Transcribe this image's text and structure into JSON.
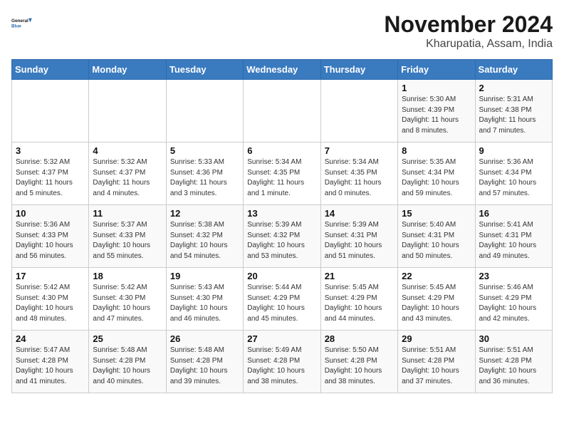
{
  "logo": {
    "line1": "General",
    "line2": "Blue"
  },
  "title": "November 2024",
  "location": "Kharupatia, Assam, India",
  "weekdays": [
    "Sunday",
    "Monday",
    "Tuesday",
    "Wednesday",
    "Thursday",
    "Friday",
    "Saturday"
  ],
  "weeks": [
    [
      {
        "day": "",
        "info": ""
      },
      {
        "day": "",
        "info": ""
      },
      {
        "day": "",
        "info": ""
      },
      {
        "day": "",
        "info": ""
      },
      {
        "day": "",
        "info": ""
      },
      {
        "day": "1",
        "info": "Sunrise: 5:30 AM\nSunset: 4:39 PM\nDaylight: 11 hours\nand 8 minutes."
      },
      {
        "day": "2",
        "info": "Sunrise: 5:31 AM\nSunset: 4:38 PM\nDaylight: 11 hours\nand 7 minutes."
      }
    ],
    [
      {
        "day": "3",
        "info": "Sunrise: 5:32 AM\nSunset: 4:37 PM\nDaylight: 11 hours\nand 5 minutes."
      },
      {
        "day": "4",
        "info": "Sunrise: 5:32 AM\nSunset: 4:37 PM\nDaylight: 11 hours\nand 4 minutes."
      },
      {
        "day": "5",
        "info": "Sunrise: 5:33 AM\nSunset: 4:36 PM\nDaylight: 11 hours\nand 3 minutes."
      },
      {
        "day": "6",
        "info": "Sunrise: 5:34 AM\nSunset: 4:35 PM\nDaylight: 11 hours\nand 1 minute."
      },
      {
        "day": "7",
        "info": "Sunrise: 5:34 AM\nSunset: 4:35 PM\nDaylight: 11 hours\nand 0 minutes."
      },
      {
        "day": "8",
        "info": "Sunrise: 5:35 AM\nSunset: 4:34 PM\nDaylight: 10 hours\nand 59 minutes."
      },
      {
        "day": "9",
        "info": "Sunrise: 5:36 AM\nSunset: 4:34 PM\nDaylight: 10 hours\nand 57 minutes."
      }
    ],
    [
      {
        "day": "10",
        "info": "Sunrise: 5:36 AM\nSunset: 4:33 PM\nDaylight: 10 hours\nand 56 minutes."
      },
      {
        "day": "11",
        "info": "Sunrise: 5:37 AM\nSunset: 4:33 PM\nDaylight: 10 hours\nand 55 minutes."
      },
      {
        "day": "12",
        "info": "Sunrise: 5:38 AM\nSunset: 4:32 PM\nDaylight: 10 hours\nand 54 minutes."
      },
      {
        "day": "13",
        "info": "Sunrise: 5:39 AM\nSunset: 4:32 PM\nDaylight: 10 hours\nand 53 minutes."
      },
      {
        "day": "14",
        "info": "Sunrise: 5:39 AM\nSunset: 4:31 PM\nDaylight: 10 hours\nand 51 minutes."
      },
      {
        "day": "15",
        "info": "Sunrise: 5:40 AM\nSunset: 4:31 PM\nDaylight: 10 hours\nand 50 minutes."
      },
      {
        "day": "16",
        "info": "Sunrise: 5:41 AM\nSunset: 4:31 PM\nDaylight: 10 hours\nand 49 minutes."
      }
    ],
    [
      {
        "day": "17",
        "info": "Sunrise: 5:42 AM\nSunset: 4:30 PM\nDaylight: 10 hours\nand 48 minutes."
      },
      {
        "day": "18",
        "info": "Sunrise: 5:42 AM\nSunset: 4:30 PM\nDaylight: 10 hours\nand 47 minutes."
      },
      {
        "day": "19",
        "info": "Sunrise: 5:43 AM\nSunset: 4:30 PM\nDaylight: 10 hours\nand 46 minutes."
      },
      {
        "day": "20",
        "info": "Sunrise: 5:44 AM\nSunset: 4:29 PM\nDaylight: 10 hours\nand 45 minutes."
      },
      {
        "day": "21",
        "info": "Sunrise: 5:45 AM\nSunset: 4:29 PM\nDaylight: 10 hours\nand 44 minutes."
      },
      {
        "day": "22",
        "info": "Sunrise: 5:45 AM\nSunset: 4:29 PM\nDaylight: 10 hours\nand 43 minutes."
      },
      {
        "day": "23",
        "info": "Sunrise: 5:46 AM\nSunset: 4:29 PM\nDaylight: 10 hours\nand 42 minutes."
      }
    ],
    [
      {
        "day": "24",
        "info": "Sunrise: 5:47 AM\nSunset: 4:28 PM\nDaylight: 10 hours\nand 41 minutes."
      },
      {
        "day": "25",
        "info": "Sunrise: 5:48 AM\nSunset: 4:28 PM\nDaylight: 10 hours\nand 40 minutes."
      },
      {
        "day": "26",
        "info": "Sunrise: 5:48 AM\nSunset: 4:28 PM\nDaylight: 10 hours\nand 39 minutes."
      },
      {
        "day": "27",
        "info": "Sunrise: 5:49 AM\nSunset: 4:28 PM\nDaylight: 10 hours\nand 38 minutes."
      },
      {
        "day": "28",
        "info": "Sunrise: 5:50 AM\nSunset: 4:28 PM\nDaylight: 10 hours\nand 38 minutes."
      },
      {
        "day": "29",
        "info": "Sunrise: 5:51 AM\nSunset: 4:28 PM\nDaylight: 10 hours\nand 37 minutes."
      },
      {
        "day": "30",
        "info": "Sunrise: 5:51 AM\nSunset: 4:28 PM\nDaylight: 10 hours\nand 36 minutes."
      }
    ]
  ]
}
